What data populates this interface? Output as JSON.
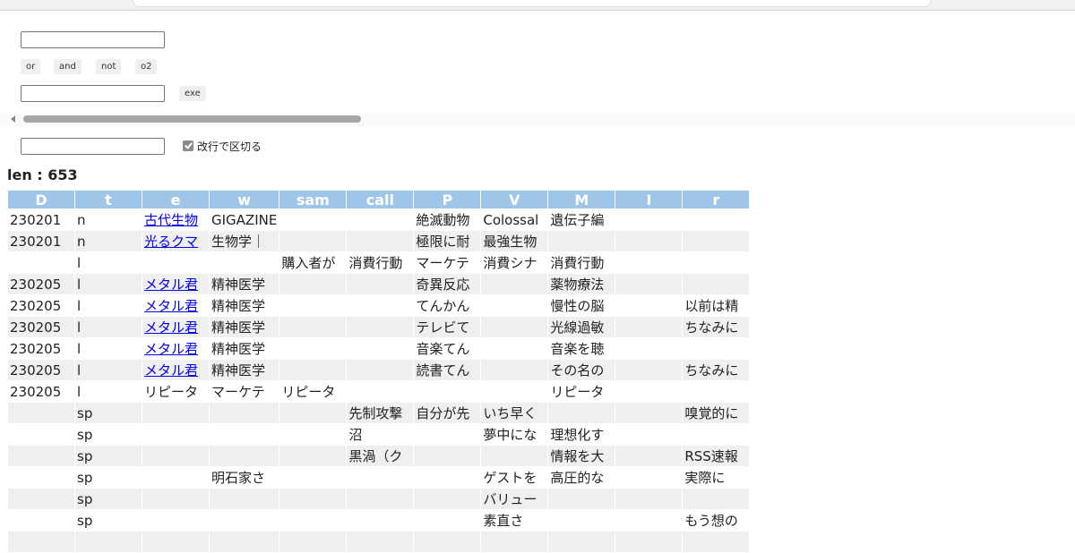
{
  "controls": {
    "ops": [
      "or",
      "and",
      "not",
      "o2"
    ],
    "exe_label": "exe",
    "checkbox_label": "改行で区切る",
    "checkbox_checked": true
  },
  "summary": {
    "len_text": "len : 653"
  },
  "table": {
    "headers": [
      "D",
      "t",
      "e",
      "w",
      "sam",
      "call",
      "P",
      "V",
      "M",
      "I",
      "r"
    ],
    "rows": [
      {
        "D": "230201",
        "t": "n",
        "e": "古代生物",
        "e_link": true,
        "w": "GIGAZINE",
        "sam": "",
        "call": "",
        "P": "絶滅動物",
        "V": "Colossal",
        "M": "遺伝子編",
        "I": "",
        "r": ""
      },
      {
        "D": "230201",
        "t": "n",
        "e": "光るクマ",
        "e_link": true,
        "w": "生物学｜",
        "sam": "",
        "call": "",
        "P": "極限に耐",
        "V": "最強生物",
        "M": "",
        "I": "",
        "r": ""
      },
      {
        "D": "",
        "t": "l",
        "e": "",
        "e_link": false,
        "w": "",
        "sam": "購入者が",
        "call": "消費行動",
        "P": "マーケテ",
        "V": "消費シナ",
        "M": "消費行動",
        "I": "",
        "r": ""
      },
      {
        "D": "230205",
        "t": "l",
        "e": "メタル君",
        "e_link": true,
        "w": "精神医学",
        "sam": "",
        "call": "",
        "P": "奇異反応",
        "V": "",
        "M": "薬物療法",
        "I": "",
        "r": ""
      },
      {
        "D": "230205",
        "t": "l",
        "e": "メタル君",
        "e_link": true,
        "w": "精神医学",
        "sam": "",
        "call": "",
        "P": "てんかん",
        "V": "",
        "M": "慢性の脳",
        "I": "",
        "r": "以前は精"
      },
      {
        "D": "230205",
        "t": "l",
        "e": "メタル君",
        "e_link": true,
        "w": "精神医学",
        "sam": "",
        "call": "",
        "P": "テレビて",
        "V": "",
        "M": "光線過敏",
        "I": "",
        "r": "ちなみに"
      },
      {
        "D": "230205",
        "t": "l",
        "e": "メタル君",
        "e_link": true,
        "w": "精神医学",
        "sam": "",
        "call": "",
        "P": "音楽てん",
        "V": "",
        "M": "音楽を聴",
        "I": "",
        "r": ""
      },
      {
        "D": "230205",
        "t": "l",
        "e": "メタル君",
        "e_link": true,
        "w": "精神医学",
        "sam": "",
        "call": "",
        "P": "読書てん",
        "V": "",
        "M": "その名の",
        "I": "",
        "r": "ちなみに"
      },
      {
        "D": "230205",
        "t": "l",
        "e": "リピータ",
        "e_link": false,
        "w": "マーケテ",
        "sam": "リピータ",
        "call": "",
        "P": "",
        "V": "",
        "M": "リピータ",
        "I": "",
        "r": ""
      },
      {
        "D": "",
        "t": "sp",
        "e": "",
        "e_link": false,
        "w": "",
        "sam": "",
        "call": "先制攻撃",
        "P": "自分が先",
        "V": "いち早く",
        "M": "",
        "I": "",
        "r": "嗅覚的に"
      },
      {
        "D": "",
        "t": "sp",
        "e": "",
        "e_link": false,
        "w": "",
        "sam": "",
        "call": "沼",
        "P": "",
        "V": "夢中にな",
        "M": "理想化す",
        "I": "",
        "r": ""
      },
      {
        "D": "",
        "t": "sp",
        "e": "",
        "e_link": false,
        "w": "",
        "sam": "",
        "call": "黒渦（ク",
        "P": "",
        "V": "",
        "M": "情報を大",
        "I": "",
        "r": "RSS速報"
      },
      {
        "D": "",
        "t": "sp",
        "e": "",
        "e_link": false,
        "w": "明石家さ",
        "sam": "",
        "call": "",
        "P": "",
        "V": "ゲストを",
        "M": "高圧的な",
        "I": "",
        "r": "実際に"
      },
      {
        "D": "",
        "t": "sp",
        "e": "",
        "e_link": false,
        "w": "",
        "sam": "",
        "call": "",
        "P": "",
        "V": "バリュー",
        "M": "",
        "I": "",
        "r": ""
      },
      {
        "D": "",
        "t": "sp",
        "e": "",
        "e_link": false,
        "w": "",
        "sam": "",
        "call": "",
        "P": "",
        "V": "素直さ",
        "M": "",
        "I": "",
        "r": "もう想の"
      },
      {
        "D": "",
        "t": "",
        "e": "",
        "e_link": false,
        "w": "",
        "sam": "",
        "call": "",
        "P": "",
        "V": "",
        "M": "",
        "I": "",
        "r": ""
      }
    ]
  }
}
